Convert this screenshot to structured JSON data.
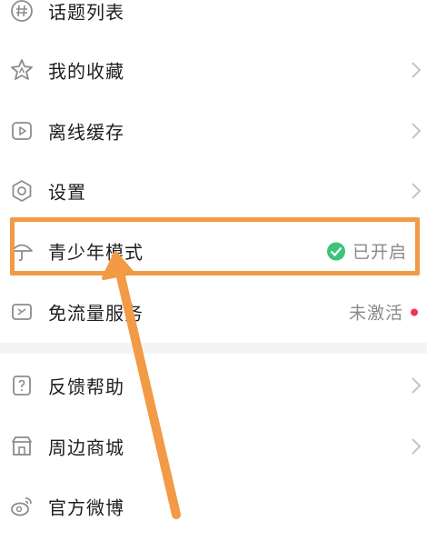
{
  "menu": {
    "topic_list": {
      "label": "话题列表",
      "icon": "hashtag-icon"
    },
    "my_favorites": {
      "label": "我的收藏",
      "icon": "star-icon"
    },
    "offline_cache": {
      "label": "离线缓存",
      "icon": "download-video-icon"
    },
    "settings": {
      "label": "设置",
      "icon": "gear-icon"
    },
    "teen_mode": {
      "label": "青少年模式",
      "icon": "umbrella-icon",
      "status": "已开启",
      "status_icon": "check-circle-icon",
      "status_color": "#3cc47a"
    },
    "free_data": {
      "label": "免流量服务",
      "icon": "data-card-icon",
      "status": "未激活",
      "badge_color": "#f0344f"
    },
    "feedback": {
      "label": "反馈帮助",
      "icon": "help-icon"
    },
    "merch_store": {
      "label": "周边商城",
      "icon": "store-icon"
    },
    "official_weibo": {
      "label": "官方微博",
      "icon": "weibo-icon"
    }
  },
  "annotation": {
    "highlight_color": "#f29a45",
    "arrow_color": "#f29a45"
  }
}
